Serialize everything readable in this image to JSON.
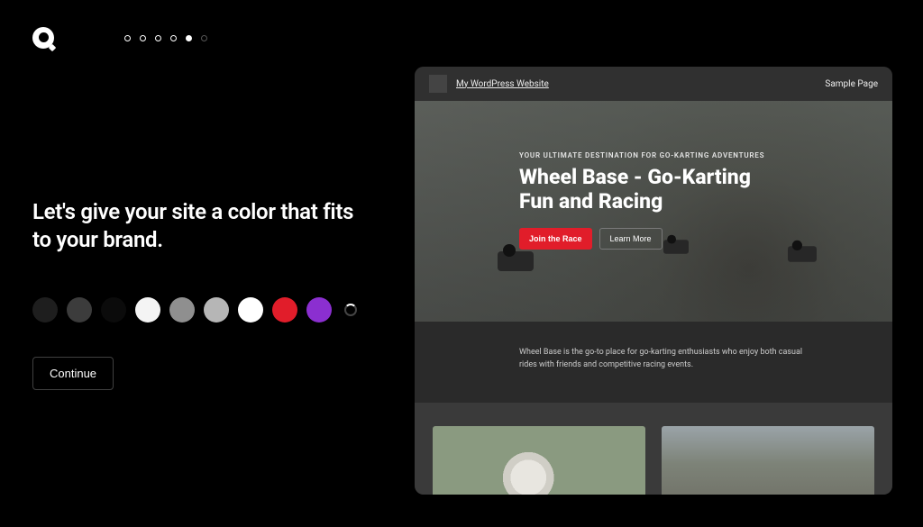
{
  "steps": {
    "total": 6,
    "current_index": 4
  },
  "heading": "Let's give your site a color that fits to your brand.",
  "swatches": [
    {
      "name": "almost-black",
      "hex": "#1e1e1e"
    },
    {
      "name": "dark-gray",
      "hex": "#3c3c3c"
    },
    {
      "name": "black",
      "hex": "#0b0b0b"
    },
    {
      "name": "white",
      "hex": "#f4f4f4"
    },
    {
      "name": "light-gray",
      "hex": "#8f8f8f"
    },
    {
      "name": "silver",
      "hex": "#b6b6b6"
    },
    {
      "name": "pure-white",
      "hex": "#ffffff"
    },
    {
      "name": "red",
      "hex": "#e11d2a"
    },
    {
      "name": "purple",
      "hex": "#8b2fd0"
    }
  ],
  "continue_label": "Continue",
  "preview": {
    "site_title": "My WordPress Website",
    "nav_link": "Sample Page",
    "hero_eyebrow": "YOUR ULTIMATE DESTINATION FOR GO-KARTING ADVENTURES",
    "hero_title": "Wheel Base - Go-Karting Fun and Racing",
    "cta_primary": "Join the Race",
    "cta_secondary": "Learn More",
    "intro_text": "Wheel Base is the go-to place for go-karting enthusiasts who enjoy both casual rides with friends and competitive racing events."
  }
}
